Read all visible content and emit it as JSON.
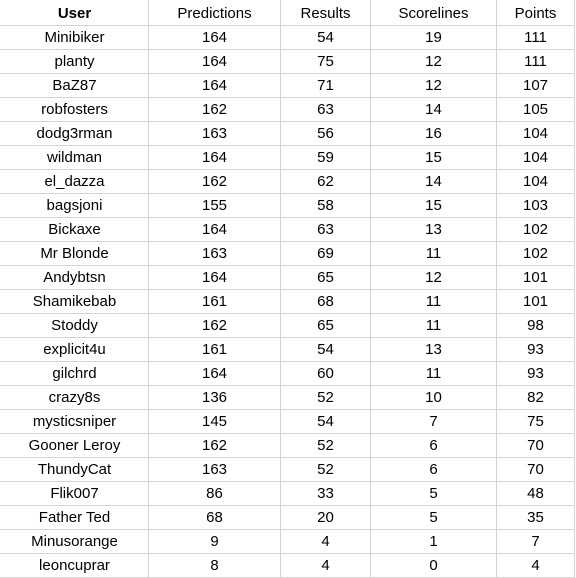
{
  "table": {
    "headers": [
      {
        "label": "User",
        "bold": true
      },
      {
        "label": "Predictions",
        "bold": false
      },
      {
        "label": "Results",
        "bold": false
      },
      {
        "label": "Scorelines",
        "bold": false
      },
      {
        "label": "Points",
        "bold": false
      }
    ],
    "rows": [
      [
        "Minibiker",
        "164",
        "54",
        "19",
        "111"
      ],
      [
        "planty",
        "164",
        "75",
        "12",
        "111"
      ],
      [
        "BaZ87",
        "164",
        "71",
        "12",
        "107"
      ],
      [
        "robfosters",
        "162",
        "63",
        "14",
        "105"
      ],
      [
        "dodg3rman",
        "163",
        "56",
        "16",
        "104"
      ],
      [
        "wildman",
        "164",
        "59",
        "15",
        "104"
      ],
      [
        "el_dazza",
        "162",
        "62",
        "14",
        "104"
      ],
      [
        "bagsjoni",
        "155",
        "58",
        "15",
        "103"
      ],
      [
        "Bickaxe",
        "164",
        "63",
        "13",
        "102"
      ],
      [
        "Mr Blonde",
        "163",
        "69",
        "11",
        "102"
      ],
      [
        "Andybtsn",
        "164",
        "65",
        "12",
        "101"
      ],
      [
        "Shamikebab",
        "161",
        "68",
        "11",
        "101"
      ],
      [
        "Stoddy",
        "162",
        "65",
        "11",
        "98"
      ],
      [
        "explicit4u",
        "161",
        "54",
        "13",
        "93"
      ],
      [
        "gilchrd",
        "164",
        "60",
        "11",
        "93"
      ],
      [
        "crazy8s",
        "136",
        "52",
        "10",
        "82"
      ],
      [
        "mysticsniper",
        "145",
        "54",
        "7",
        "75"
      ],
      [
        "Gooner Leroy",
        "162",
        "52",
        "6",
        "70"
      ],
      [
        "ThundyCat",
        "163",
        "52",
        "6",
        "70"
      ],
      [
        "Flik007",
        "86",
        "33",
        "5",
        "48"
      ],
      [
        "Father Ted",
        "68",
        "20",
        "5",
        "35"
      ],
      [
        "Minusorange",
        "9",
        "4",
        "1",
        "7"
      ],
      [
        "leoncuprar",
        "8",
        "4",
        "0",
        "4"
      ]
    ]
  },
  "colors": {
    "gridline": "#d4d4d4",
    "text": "#000000",
    "background": "#ffffff"
  }
}
